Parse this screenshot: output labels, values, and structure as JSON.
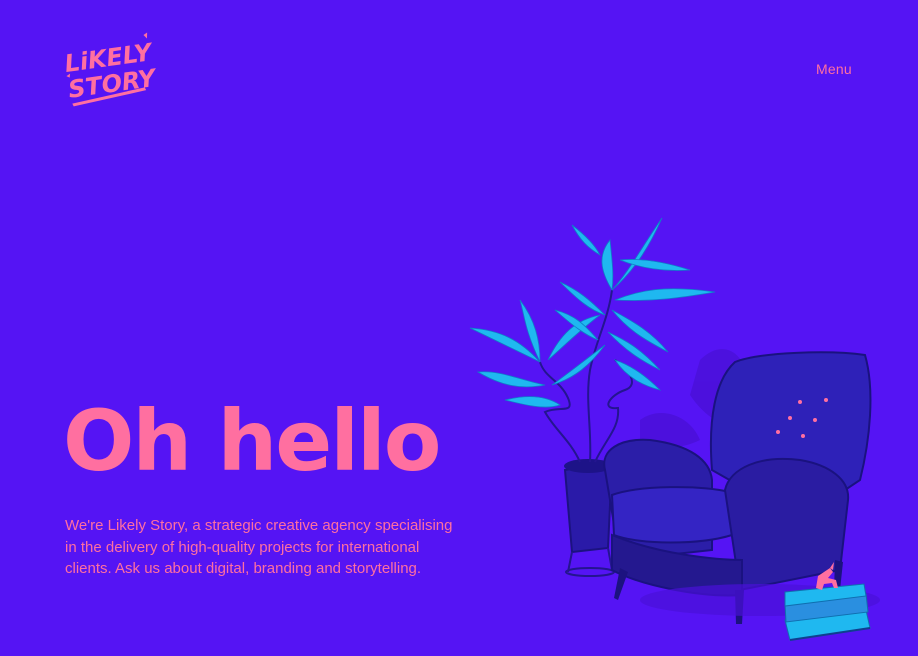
{
  "header": {
    "logo_text": "Likely Story",
    "menu_label": "Menu"
  },
  "hero": {
    "heading": "Oh hello",
    "intro": "We're Likely Story, a strategic creative agency specialising in the delivery of high-quality projects for international clients. Ask us about digital, branding and storytelling."
  },
  "colors": {
    "background": "#5514f4",
    "accent_pink": "#ff6fa0",
    "plant_cyan": "#1fb8f0",
    "chair_navy": "#2b1ea8"
  },
  "illustration": {
    "elements": [
      "plant-icon",
      "armchair-icon",
      "books-icon",
      "unicorn-icon"
    ]
  }
}
